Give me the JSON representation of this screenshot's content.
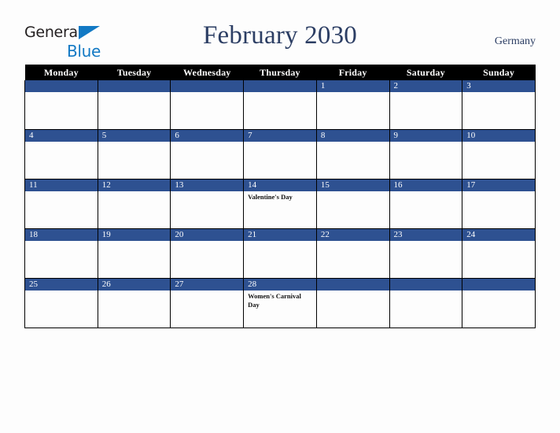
{
  "brand": {
    "word1": "General",
    "word2": "Blue",
    "triangle_color": "#1279c4",
    "word1_color": "#231f20",
    "word2_color": "#1279c4"
  },
  "header": {
    "title": "February 2030",
    "country": "Germany",
    "title_color": "#2c3e64"
  },
  "calendar": {
    "weekday_headers": [
      "Monday",
      "Tuesday",
      "Wednesday",
      "Thursday",
      "Friday",
      "Saturday",
      "Sunday"
    ],
    "header_bg": "#000000",
    "daynum_bg": "#2e5191",
    "cell_bg": "#fdfdfd",
    "weeks": [
      [
        {
          "day": "",
          "events": ""
        },
        {
          "day": "",
          "events": ""
        },
        {
          "day": "",
          "events": ""
        },
        {
          "day": "",
          "events": ""
        },
        {
          "day": "1",
          "events": ""
        },
        {
          "day": "2",
          "events": ""
        },
        {
          "day": "3",
          "events": ""
        }
      ],
      [
        {
          "day": "4",
          "events": ""
        },
        {
          "day": "5",
          "events": ""
        },
        {
          "day": "6",
          "events": ""
        },
        {
          "day": "7",
          "events": ""
        },
        {
          "day": "8",
          "events": ""
        },
        {
          "day": "9",
          "events": ""
        },
        {
          "day": "10",
          "events": ""
        }
      ],
      [
        {
          "day": "11",
          "events": ""
        },
        {
          "day": "12",
          "events": ""
        },
        {
          "day": "13",
          "events": ""
        },
        {
          "day": "14",
          "events": "Valentine's Day"
        },
        {
          "day": "15",
          "events": ""
        },
        {
          "day": "16",
          "events": ""
        },
        {
          "day": "17",
          "events": ""
        }
      ],
      [
        {
          "day": "18",
          "events": ""
        },
        {
          "day": "19",
          "events": ""
        },
        {
          "day": "20",
          "events": ""
        },
        {
          "day": "21",
          "events": ""
        },
        {
          "day": "22",
          "events": ""
        },
        {
          "day": "23",
          "events": ""
        },
        {
          "day": "24",
          "events": ""
        }
      ],
      [
        {
          "day": "25",
          "events": ""
        },
        {
          "day": "26",
          "events": ""
        },
        {
          "day": "27",
          "events": ""
        },
        {
          "day": "28",
          "events": "Women's Carnival Day"
        },
        {
          "day": "",
          "events": ""
        },
        {
          "day": "",
          "events": ""
        },
        {
          "day": "",
          "events": ""
        }
      ]
    ]
  }
}
